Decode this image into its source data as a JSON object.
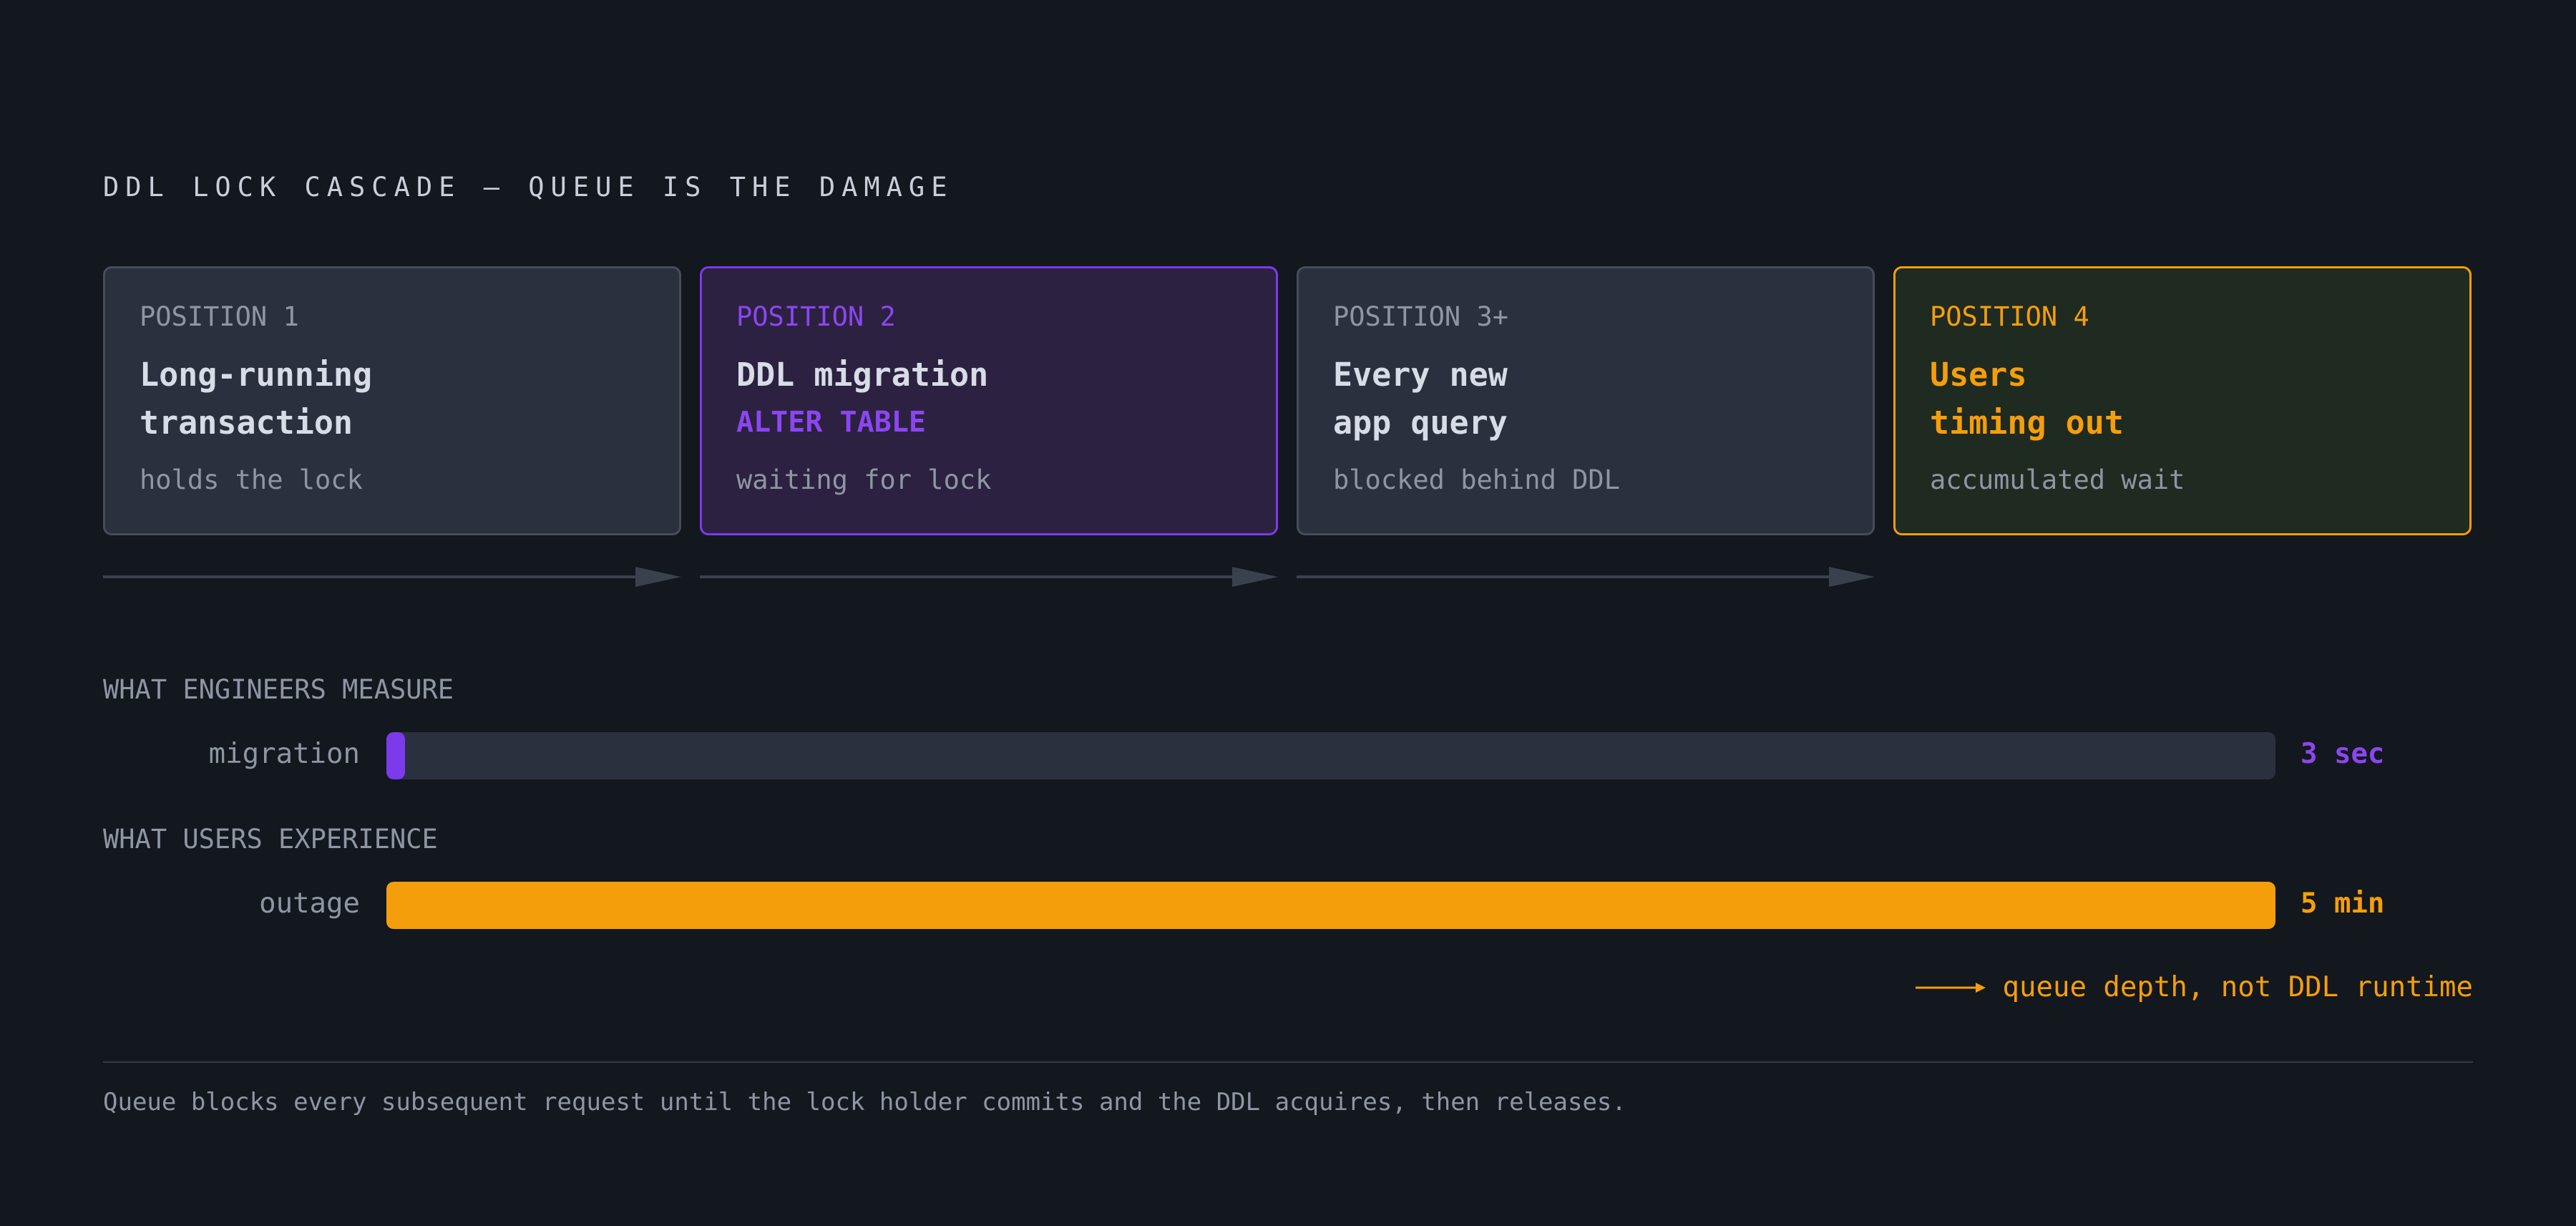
{
  "title": "DDL LOCK CASCADE — QUEUE IS THE DAMAGE",
  "colors": {
    "background": "#13171e",
    "neutral_card": "#2a303d",
    "violet": "#8b46f0",
    "amber": "#f59e0b",
    "arrow": "#3a414e"
  },
  "cards": [
    {
      "position": "POSITION 1",
      "headline": [
        "Long-running",
        "transaction"
      ],
      "subtitle": "",
      "note": "holds the lock",
      "style": "neutral"
    },
    {
      "position": "POSITION 2",
      "headline": [
        "DDL migration"
      ],
      "subtitle": "ALTER TABLE",
      "note": "waiting for lock",
      "style": "violet"
    },
    {
      "position": "POSITION 3+",
      "headline": [
        "Every new",
        "app query"
      ],
      "subtitle": "",
      "note": "blocked behind DDL",
      "style": "neutral"
    },
    {
      "position": "POSITION 4",
      "headline": [
        "Users",
        "timing out"
      ],
      "subtitle": "",
      "note": "accumulated wait",
      "style": "amber"
    }
  ],
  "measure": {
    "section": "WHAT ENGINEERS MEASURE",
    "label": "migration",
    "value": "3 sec",
    "fraction": 0.01
  },
  "experience": {
    "section": "WHAT USERS EXPERIENCE",
    "label": "outage",
    "value": "5 min",
    "fraction": 1.0
  },
  "callout": "queue depth, not DDL runtime",
  "footnote": "Queue blocks every subsequent request until the lock holder commits and the DDL acquires, then releases."
}
